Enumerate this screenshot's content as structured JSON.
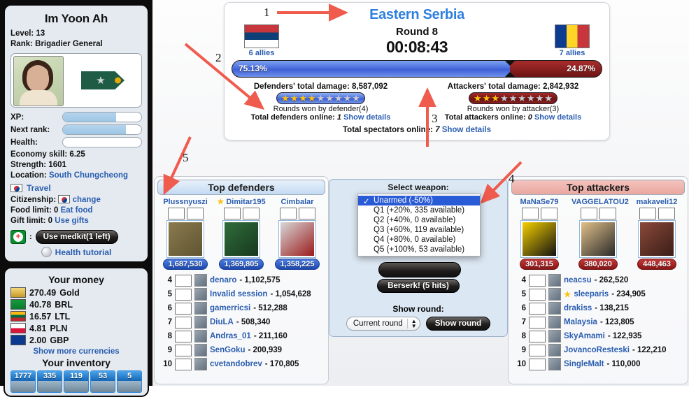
{
  "profile": {
    "name": "Im Yoon Ah",
    "level_label": "Level: 13",
    "rank_label": "Rank: Brigadier General",
    "xp_label": "XP:",
    "next_rank_label": "Next rank:",
    "health_label": "Health:",
    "xp_pct": 68,
    "next_rank_pct": 80,
    "health_pct": 0,
    "economy_skill": "Economy skill: 6.25",
    "strength": "Strength: 1601",
    "location_label": "Location:",
    "location_value": "South Chungcheong",
    "travel": "Travel",
    "citizenship_label": "Citizenship:",
    "citizenship_change": "change",
    "food_limit": "Food limit: 0",
    "eat_food": "Eat food",
    "gift_limit": "Gift limit: 0",
    "use_gifts": "Use gifts",
    "medkit_button": "Use medkit(1 left)",
    "health_tutorial": "Health tutorial"
  },
  "money": {
    "title": "Your money",
    "show_more": "Show more currencies",
    "items": [
      {
        "amount": "270.49",
        "currency": "Gold",
        "icon": "gold-bar-icon"
      },
      {
        "amount": "40.78",
        "currency": "BRL",
        "icon": "flag-brazil-icon"
      },
      {
        "amount": "16.57",
        "currency": "LTL",
        "icon": "flag-lithuania-icon"
      },
      {
        "amount": "4.81",
        "currency": "PLN",
        "icon": "flag-poland-icon"
      },
      {
        "amount": "2.00",
        "currency": "GBP",
        "icon": "flag-uk-icon"
      }
    ]
  },
  "inventory": {
    "title": "Your inventory",
    "counts": [
      "1777",
      "335",
      "119",
      "53",
      "5"
    ]
  },
  "battle": {
    "region": "Eastern Serbia",
    "round": "Round 8",
    "timer": "00:08:43",
    "defender_allies": "6 allies",
    "attacker_allies": "7 allies",
    "defender_pct": "75.13%",
    "attacker_pct": "24.87%",
    "defender_pct_value": 75.13,
    "attacker_pct_value": 24.87,
    "defenders_damage": "Defenders' total damage: 8,587,092",
    "attackers_damage": "Attackers' total damage: 2,842,932",
    "defender_stars_on": 4,
    "attacker_stars_on": 3,
    "stars_total": 9,
    "rounds_won_defender": "Rounds won by defender(4)",
    "rounds_won_attacker": "Rounds won by attacker(3)",
    "defenders_online_label": "Total defenders online:",
    "defenders_online_value": "1",
    "attackers_online_label": "Total attackers online:",
    "attackers_online_value": "0",
    "show_details": "Show details",
    "spectators_label": "Total spectators online:",
    "spectators_value": "7",
    "spectators_link": "Show details"
  },
  "defenders": {
    "header": "Top defenders",
    "podium": [
      {
        "name": "Plussnyuszi",
        "score": "1,687,530",
        "starred": false
      },
      {
        "name": "Dimitar195",
        "score": "1,369,805",
        "starred": true
      },
      {
        "name": "Cimbalar",
        "score": "1,358,225",
        "starred": false
      }
    ],
    "rows": [
      {
        "rank": "4",
        "name": "denaro",
        "score": "1,102,575",
        "starred": false
      },
      {
        "rank": "5",
        "name": "Invalid session",
        "score": "1,054,628",
        "starred": false
      },
      {
        "rank": "6",
        "name": "gamerricsi",
        "score": "512,288",
        "starred": false
      },
      {
        "rank": "7",
        "name": "DiuLA",
        "score": "508,340",
        "starred": false
      },
      {
        "rank": "8",
        "name": "Andras_01",
        "score": "211,160",
        "starred": false
      },
      {
        "rank": "9",
        "name": "SenGoku",
        "score": "200,939",
        "starred": false
      },
      {
        "rank": "10",
        "name": "cvetandobrev",
        "score": "170,805",
        "starred": false
      }
    ]
  },
  "attackers": {
    "header": "Top attackers",
    "podium": [
      {
        "name": "MaNaSe79",
        "score": "301,315",
        "starred": false
      },
      {
        "name": "VAGGELATOU2",
        "score": "380,020",
        "starred": false
      },
      {
        "name": "makaveli12",
        "score": "448,463",
        "starred": false
      }
    ],
    "rows": [
      {
        "rank": "4",
        "name": "neacsu",
        "score": "262,520",
        "starred": false
      },
      {
        "rank": "5",
        "name": "sleeparis",
        "score": "234,905",
        "starred": true
      },
      {
        "rank": "6",
        "name": "drakiss",
        "score": "138,215",
        "starred": false
      },
      {
        "rank": "7",
        "name": "Malaysia",
        "score": "123,805",
        "starred": false
      },
      {
        "rank": "8",
        "name": "SkyAmami",
        "score": "122,935",
        "starred": false
      },
      {
        "rank": "9",
        "name": "JovancoResteski",
        "score": "122,210",
        "starred": false
      },
      {
        "rank": "10",
        "name": "SingleMalt",
        "score": "110,000",
        "starred": false
      }
    ]
  },
  "weapon_panel": {
    "select_label": "Select weapon:",
    "options": [
      "Unarmed (-50%)",
      "Q1 (+20%, 335 available)",
      "Q2 (+40%, 0 available)",
      "Q3 (+60%, 119 available)",
      "Q4 (+80%, 0 available)",
      "Q5 (+100%, 53 available)"
    ],
    "selected_index": 0,
    "berserk_button": "Berserk! (5 hits)",
    "show_round_label": "Show round:",
    "round_select_value": "Current round",
    "show_round_button": "Show round"
  },
  "annotations": {
    "numbers": [
      "1",
      "2",
      "3",
      "4",
      "5"
    ]
  },
  "colors": {
    "link": "#2a5db0",
    "title": "#2f7fe0",
    "defender": "#3f62d8",
    "attacker": "#8d1414",
    "arrow": "#ef5b4d"
  }
}
